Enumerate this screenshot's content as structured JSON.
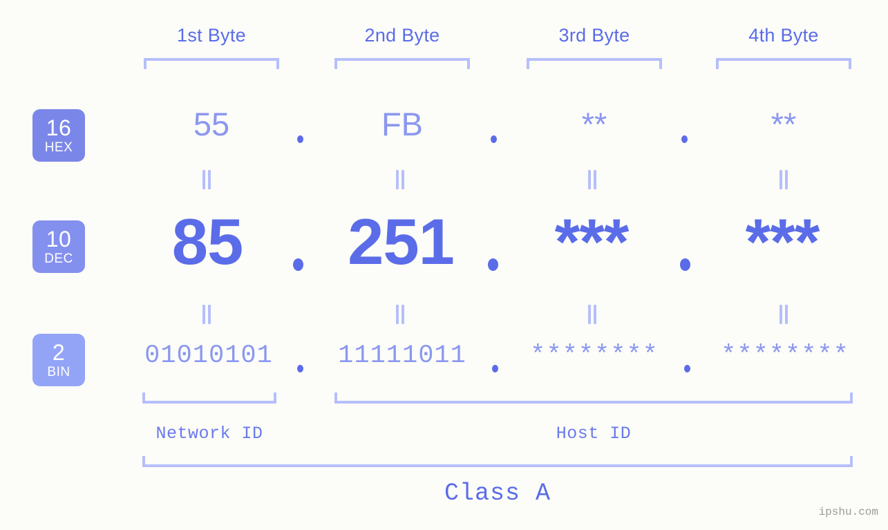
{
  "diagram": {
    "ip_address": "85.251.***.***",
    "class_label": "Class A",
    "watermark": "ipshu.com"
  },
  "byte_headers": [
    {
      "label": "1st Byte"
    },
    {
      "label": "2nd Byte"
    },
    {
      "label": "3rd Byte"
    },
    {
      "label": "4th Byte"
    }
  ],
  "bases": [
    {
      "number": "16",
      "name": "HEX",
      "color": "#7b87e8"
    },
    {
      "number": "10",
      "name": "DEC",
      "color": "#8490ee"
    },
    {
      "number": "2",
      "name": "BIN",
      "color": "#93a4f7"
    }
  ],
  "rows": {
    "hex": {
      "values": [
        "55",
        "FB",
        "**",
        "**"
      ]
    },
    "dec": {
      "values": [
        "85",
        "251",
        "***",
        "***"
      ]
    },
    "bin": {
      "values": [
        "01010101",
        "11111011",
        "********",
        "********"
      ]
    }
  },
  "separator": ".",
  "equals_mark": "||",
  "sections": [
    {
      "label": "Network ID"
    },
    {
      "label": "Host ID"
    }
  ],
  "colors": {
    "background": "#fcfdf9",
    "accent": "#5b6ce8",
    "accent_light": "#8b97ef",
    "bracket": "#b6bffb",
    "watermark": "#9a9a9a"
  }
}
